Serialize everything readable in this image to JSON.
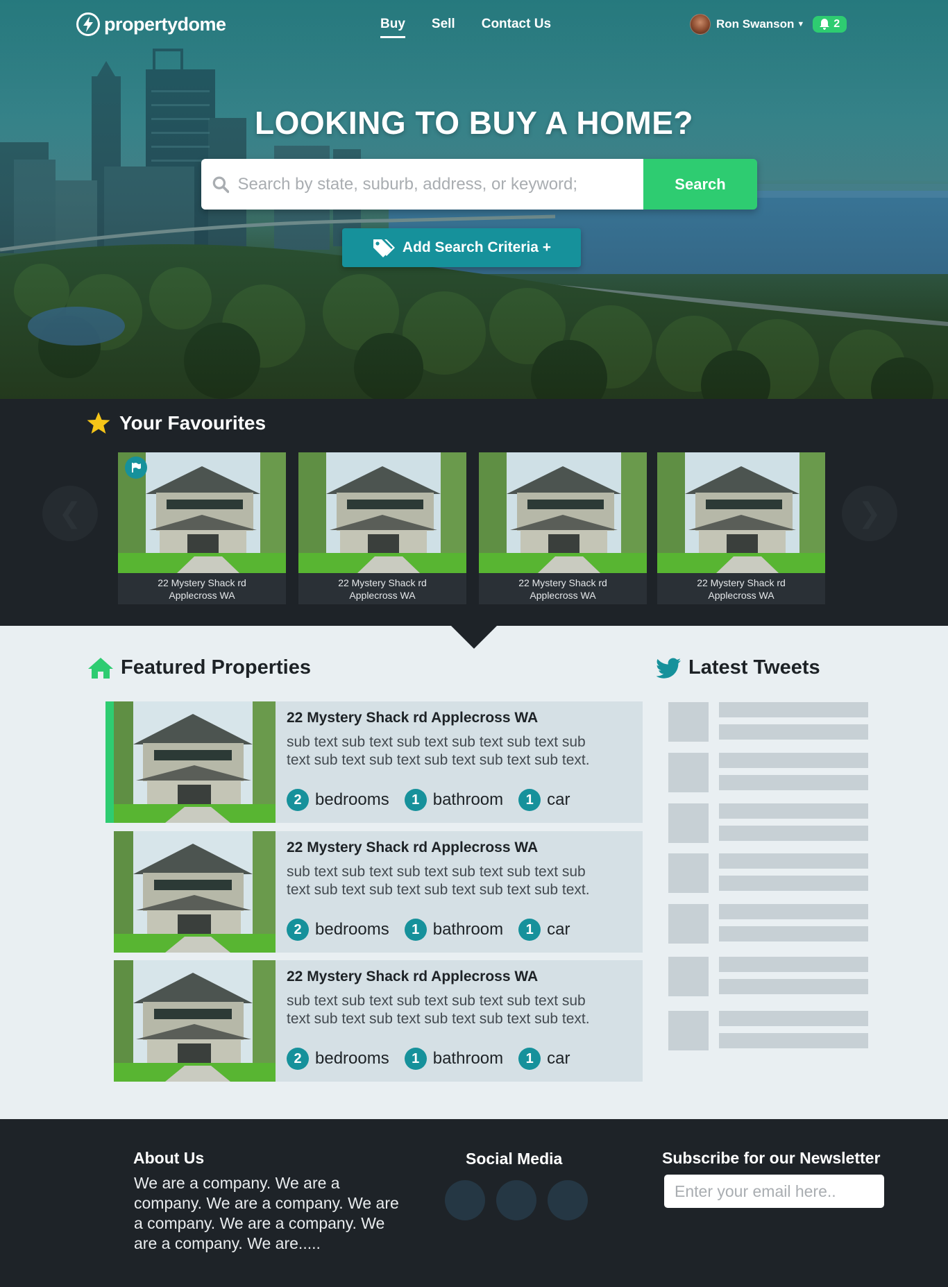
{
  "brand": {
    "name": "propertydome"
  },
  "nav": {
    "links": [
      {
        "label": "Buy",
        "active": true
      },
      {
        "label": "Sell",
        "active": false
      },
      {
        "label": "Contact Us",
        "active": false
      }
    ]
  },
  "user": {
    "name": "Ron Swanson",
    "notifications": "2"
  },
  "hero": {
    "title": "LOOKING TO BUY A HOME?",
    "search_placeholder": "Search by state, suburb, address, or keyword;",
    "search_button": "Search",
    "criteria_button": "Add Search Criteria +"
  },
  "favourites": {
    "title": "Your Favourites",
    "items": [
      {
        "line1": "22 Mystery Shack rd",
        "line2": "Applecross WA",
        "flagged": true
      },
      {
        "line1": "22 Mystery Shack rd",
        "line2": "Applecross WA",
        "flagged": false
      },
      {
        "line1": "22 Mystery Shack rd",
        "line2": "Applecross WA",
        "flagged": false
      },
      {
        "line1": "22 Mystery Shack rd",
        "line2": "Applecross WA",
        "flagged": false
      }
    ]
  },
  "featured": {
    "title": "Featured Properties",
    "items": [
      {
        "title": "22 Mystery Shack rd Applecross WA",
        "desc": "sub text sub text sub text sub text sub text sub text sub text sub text sub text sub text sub text.",
        "bedrooms": "2",
        "bedrooms_label": "bedrooms",
        "bathrooms": "1",
        "bathrooms_label": "bathroom",
        "cars": "1",
        "cars_label": "car",
        "selected": true
      },
      {
        "title": "22 Mystery Shack rd Applecross WA",
        "desc": "sub text sub text sub text sub text sub text sub text sub text sub text sub text sub text sub text.",
        "bedrooms": "2",
        "bedrooms_label": "bedrooms",
        "bathrooms": "1",
        "bathrooms_label": "bathroom",
        "cars": "1",
        "cars_label": "car",
        "selected": false
      },
      {
        "title": "22 Mystery Shack rd Applecross WA",
        "desc": "sub text sub text sub text sub text sub text sub text sub text sub text sub text sub text sub text.",
        "bedrooms": "2",
        "bedrooms_label": "bedrooms",
        "bathrooms": "1",
        "bathrooms_label": "bathroom",
        "cars": "1",
        "cars_label": "car",
        "selected": false
      }
    ]
  },
  "tweets": {
    "title": "Latest Tweets",
    "placeholder_count": 7
  },
  "footer": {
    "about_title": "About Us",
    "about_text": "We are a company. We are a company. We are a company. We are a company. We are a company. We are a company. We are.....",
    "social_title": "Social Media",
    "newsletter_title": "Subscribe for our Newsletter",
    "newsletter_placeholder": "Enter your email here.."
  },
  "colors": {
    "accent_green": "#2ecc71",
    "accent_teal": "#16919b",
    "dark": "#1e2328",
    "light_bg": "#e9eff2"
  }
}
